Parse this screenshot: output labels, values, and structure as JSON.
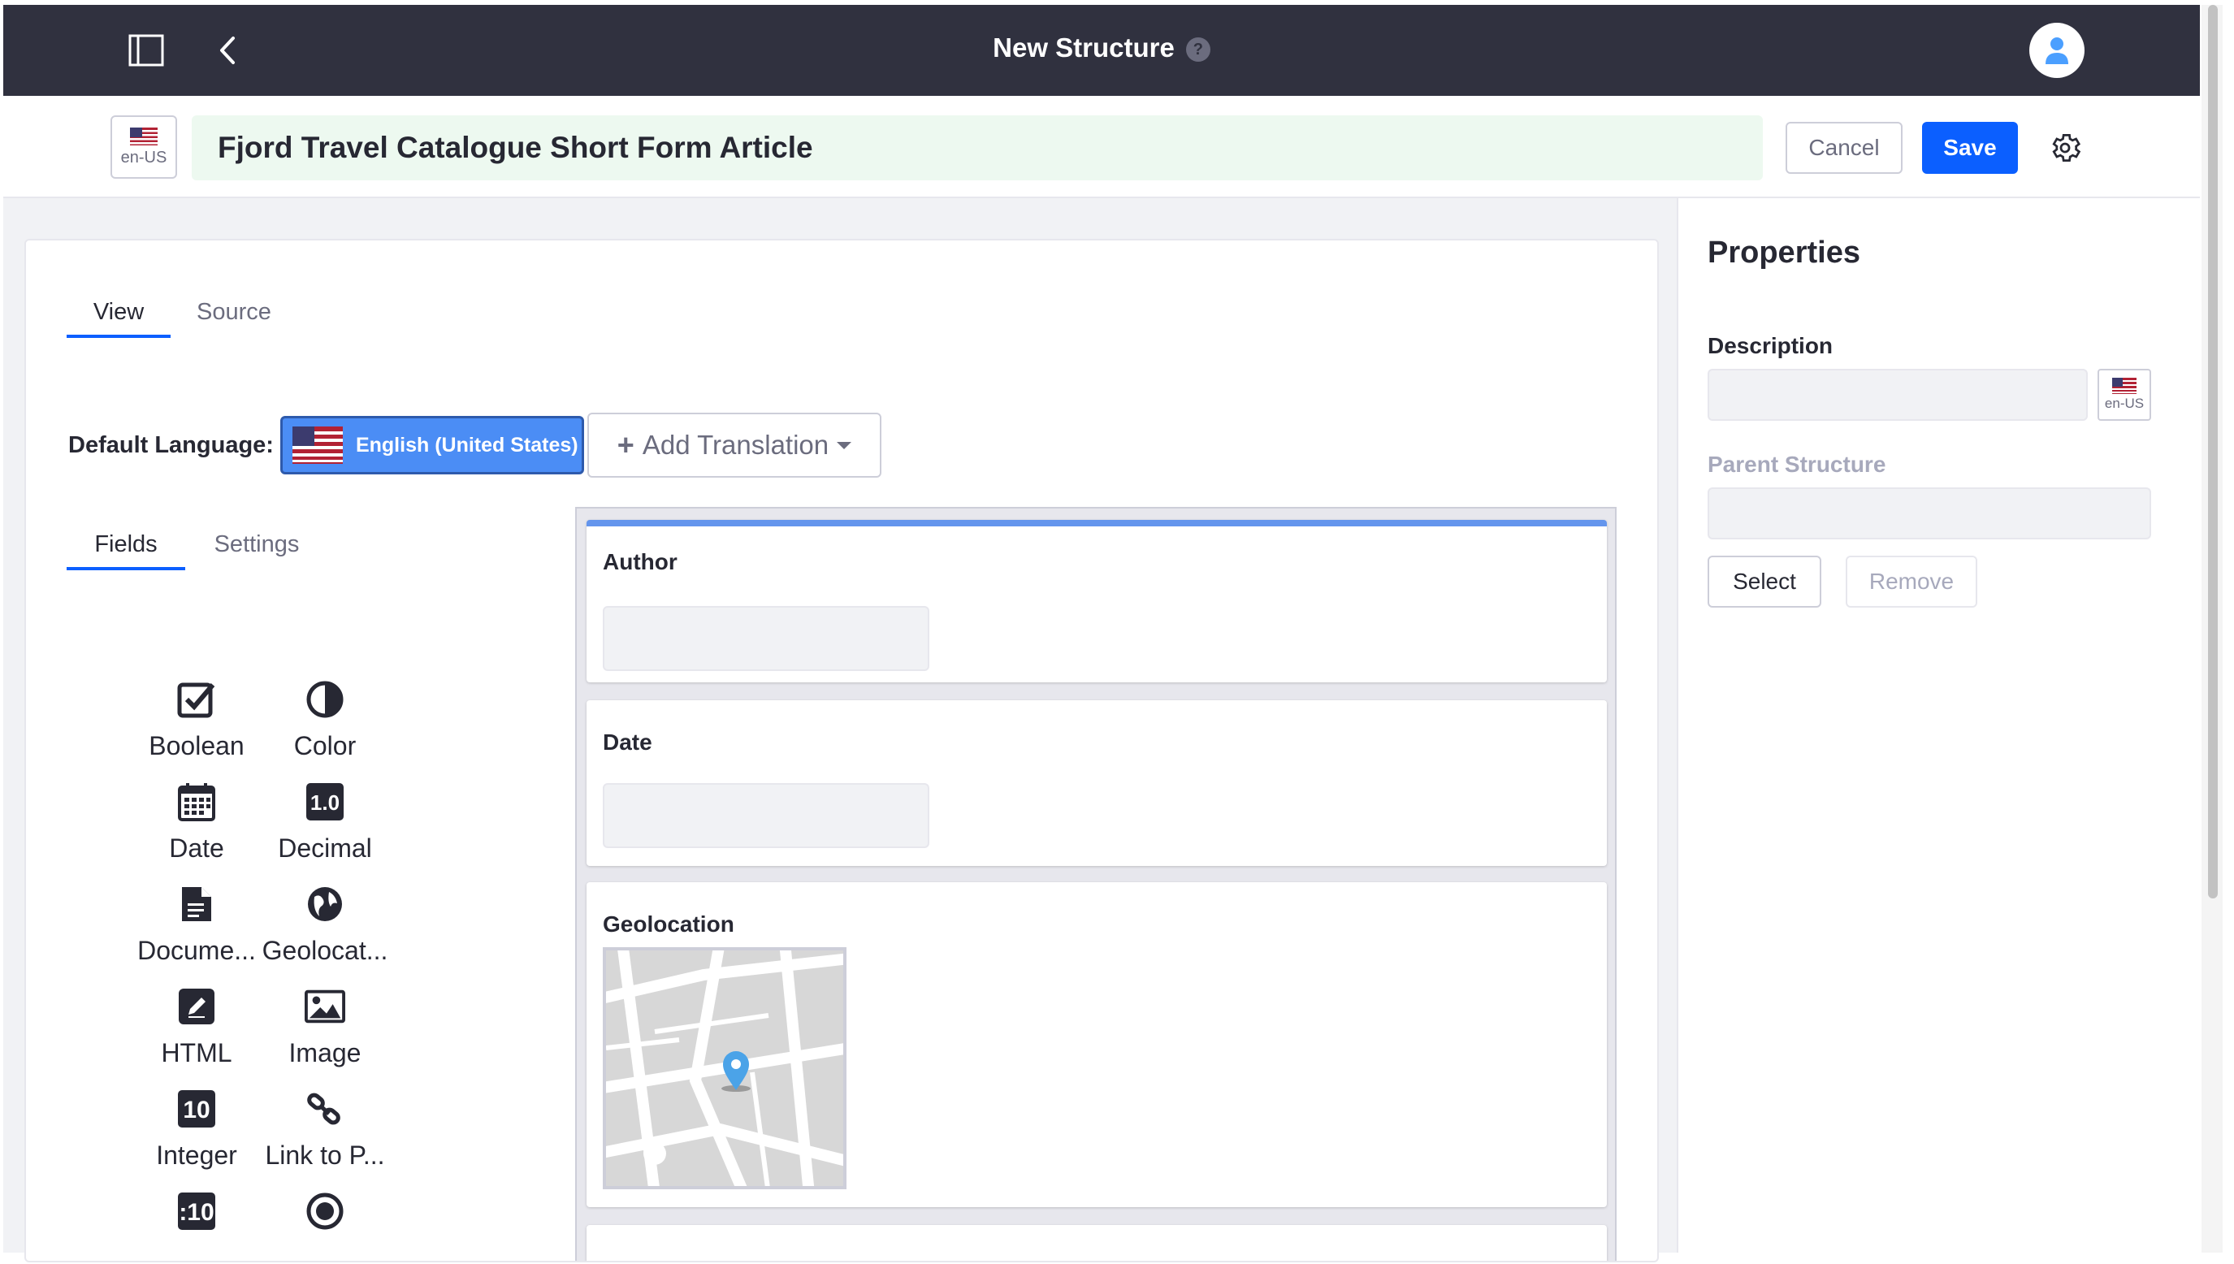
{
  "topbar": {
    "title": "New Structure",
    "help": "?"
  },
  "header": {
    "locale": "en-US",
    "structure_name": "Fjord Travel Catalogue Short Form Article",
    "cancel_label": "Cancel",
    "save_label": "Save"
  },
  "view_tabs": [
    {
      "label": "View",
      "active": true
    },
    {
      "label": "Source",
      "active": false
    }
  ],
  "default_language": {
    "label": "Default Language:",
    "value": "English (United States)",
    "add_translation": "Add Translation"
  },
  "sidebar_tabs": [
    {
      "label": "Fields",
      "active": true
    },
    {
      "label": "Settings",
      "active": false
    }
  ],
  "palette": [
    {
      "label": "Boolean",
      "icon": "checkbox-icon"
    },
    {
      "label": "Color",
      "icon": "color-icon"
    },
    {
      "label": "Date",
      "icon": "calendar-icon"
    },
    {
      "label": "Decimal",
      "icon": "decimal-icon"
    },
    {
      "label": "Docume...",
      "icon": "document-icon"
    },
    {
      "label": "Geolocat...",
      "icon": "globe-icon"
    },
    {
      "label": "HTML",
      "icon": "html-pencil-icon"
    },
    {
      "label": "Image",
      "icon": "image-icon"
    },
    {
      "label": "Integer",
      "icon": "integer-icon"
    },
    {
      "label": "Link to P...",
      "icon": "link-icon"
    }
  ],
  "fields": [
    {
      "title": "Author"
    },
    {
      "title": "Date"
    },
    {
      "title": "Geolocation"
    }
  ],
  "properties": {
    "title": "Properties",
    "description_label": "Description",
    "locale": "en-US",
    "parent_label": "Parent Structure",
    "select_label": "Select",
    "remove_label": "Remove"
  },
  "colors": {
    "topbar": "#30313f",
    "primary": "#0b5fff",
    "title_bg": "#edf9f0"
  }
}
